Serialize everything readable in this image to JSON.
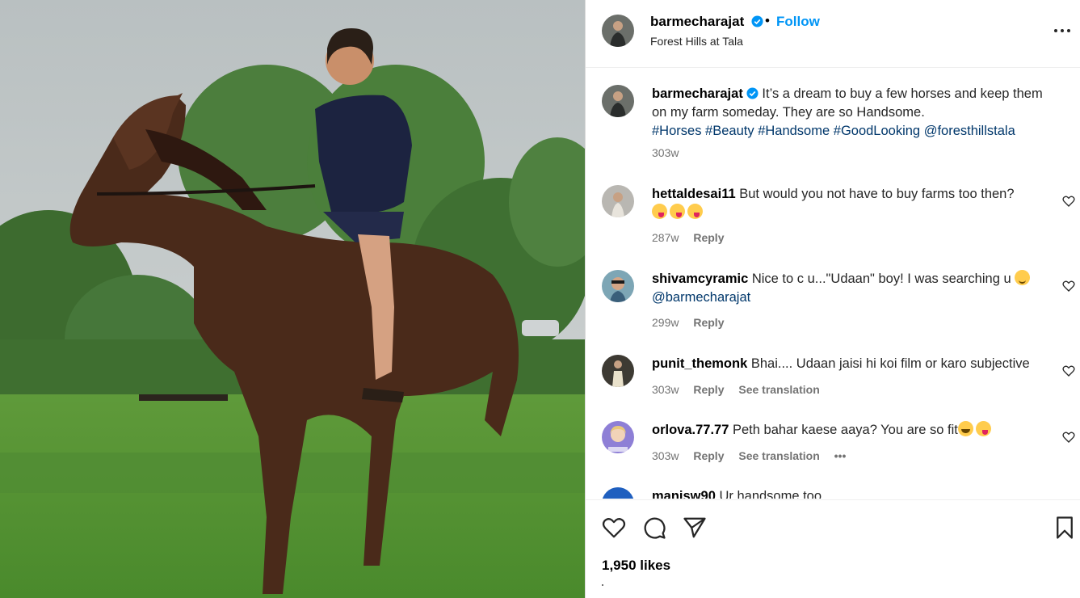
{
  "post": {
    "username": "barmecharajat",
    "follow_label": "Follow",
    "separator": "•",
    "location": "Forest Hills at Tala"
  },
  "caption": {
    "username": "barmecharajat",
    "text": "It’s a dream to buy a few horses and keep them on my farm someday. They are so Handsome.",
    "hashtags": [
      "#Horses",
      "#Beauty",
      "#Handsome",
      "#GoodLooking",
      "@foresthillstala"
    ],
    "time": "303w"
  },
  "comments": [
    {
      "username": "hettaldesai11",
      "text": "But would you not have to buy farms too then?",
      "emojis": [
        "face-savoring-food",
        "face-savoring-food",
        "face-savoring-food"
      ],
      "time": "287w",
      "reply_label": "Reply"
    },
    {
      "username": "shivamcyramic",
      "text": "Nice to c u...\"Udaan\" boy! I was searching u",
      "mention": "@barmecharajat",
      "emojis": [
        "smiling-face"
      ],
      "time": "299w",
      "reply_label": "Reply"
    },
    {
      "username": "punit_themonk",
      "text": "Bhai.... Udaan jaisi hi koi film or karo subjective",
      "time": "303w",
      "reply_label": "Reply",
      "translation_label": "See translation"
    },
    {
      "username": "orlova.77.77",
      "text": "Peth bahar kaese aaya? You are so fit",
      "emojis": [
        "face-with-tears-of-joy",
        "face-savoring-food"
      ],
      "time": "303w",
      "reply_label": "Reply",
      "translation_label": "See translation",
      "more_label": "•••"
    },
    {
      "username": "manisw90",
      "text": "Ur handsome too"
    }
  ],
  "likes": "1,950 likes",
  "icons": {
    "more": "more-options-icon",
    "verified": "verified-badge-icon",
    "like": "heart-icon",
    "comment": "comment-icon",
    "share": "share-icon",
    "save": "bookmark-icon"
  },
  "colors": {
    "accent": "#0095f6",
    "hashtag": "#00376b",
    "meta": "#737373"
  }
}
